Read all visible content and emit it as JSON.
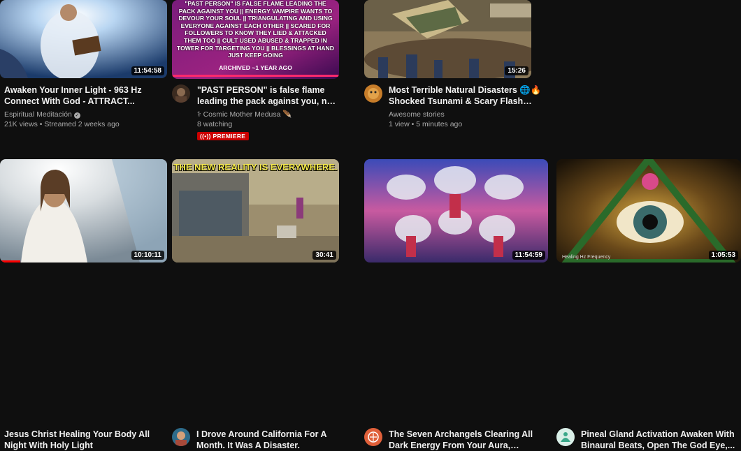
{
  "videos": [
    {
      "title": "Awaken Your Inner Light - 963 Hz Connect With God - ATTRACT...",
      "channel": "Espiritual Meditación",
      "stats": "21K views • Streamed 2 weeks ago",
      "duration": "11:54:58",
      "verified": true,
      "verified_icon": "✓"
    },
    {
      "title": "\"PAST PERSON\" is false flame leading the pack against you, not divine (1 YEA...",
      "channel": "⚕ Cosmic Mother Medusa 🪶",
      "stats": "8 watching",
      "badge": "PREMIERE",
      "badge_icon": "((•))",
      "thumb_text": "\"PAST PERSON\" IS FALSE FLAME LEADING THE PACK AGAINST YOU || ENERGY VAMPIRE WANTS TO DEVOUR YOUR SOUL || TRIANGULATING AND USING EVERYONE AGAINST EACH OTHER || SCARED FOR FOLLOWERS TO KNOW THEY LIED & ATTACKED THEM TOO || CULT USED ABUSED & TRAPPED IN TOWER FOR TARGETING YOU || BLESSINGS AT HAND JUST KEEP GOING",
      "thumb_footer": "ARCHIVED ~1 YEAR AGO"
    },
    {
      "title": "Most Terrible Natural Disasters 🌐🔥 Shocked Tsunami & Scary Flash Flood ...",
      "channel": "Awesome stories",
      "stats": "1 view • 5 minutes ago",
      "duration": "15:26"
    },
    {
      "title": "Jesus Christ Healing Your Body All Night With Holy Light",
      "duration": "10:10:11"
    },
    {
      "title": "I Drove Around California For A Month. It Was A Disaster.",
      "duration": "30:41",
      "thumb_text": "THE NEW REALITY IS EVERYWHERE."
    },
    {
      "title": "The Seven Archangels Clearing All Dark Energy From Your Aura, Archangel...",
      "duration": "11:54:59"
    },
    {
      "title": "Pineal Gland Activation Awaken With Binaural Beats, Open The God Eye,...",
      "duration": "1:05:53",
      "thumb_text": "Healing Hz Frequency"
    }
  ],
  "colors": {
    "background": "#0f0f0f",
    "premiere": "#cc0000",
    "progress": "#ff0000"
  }
}
